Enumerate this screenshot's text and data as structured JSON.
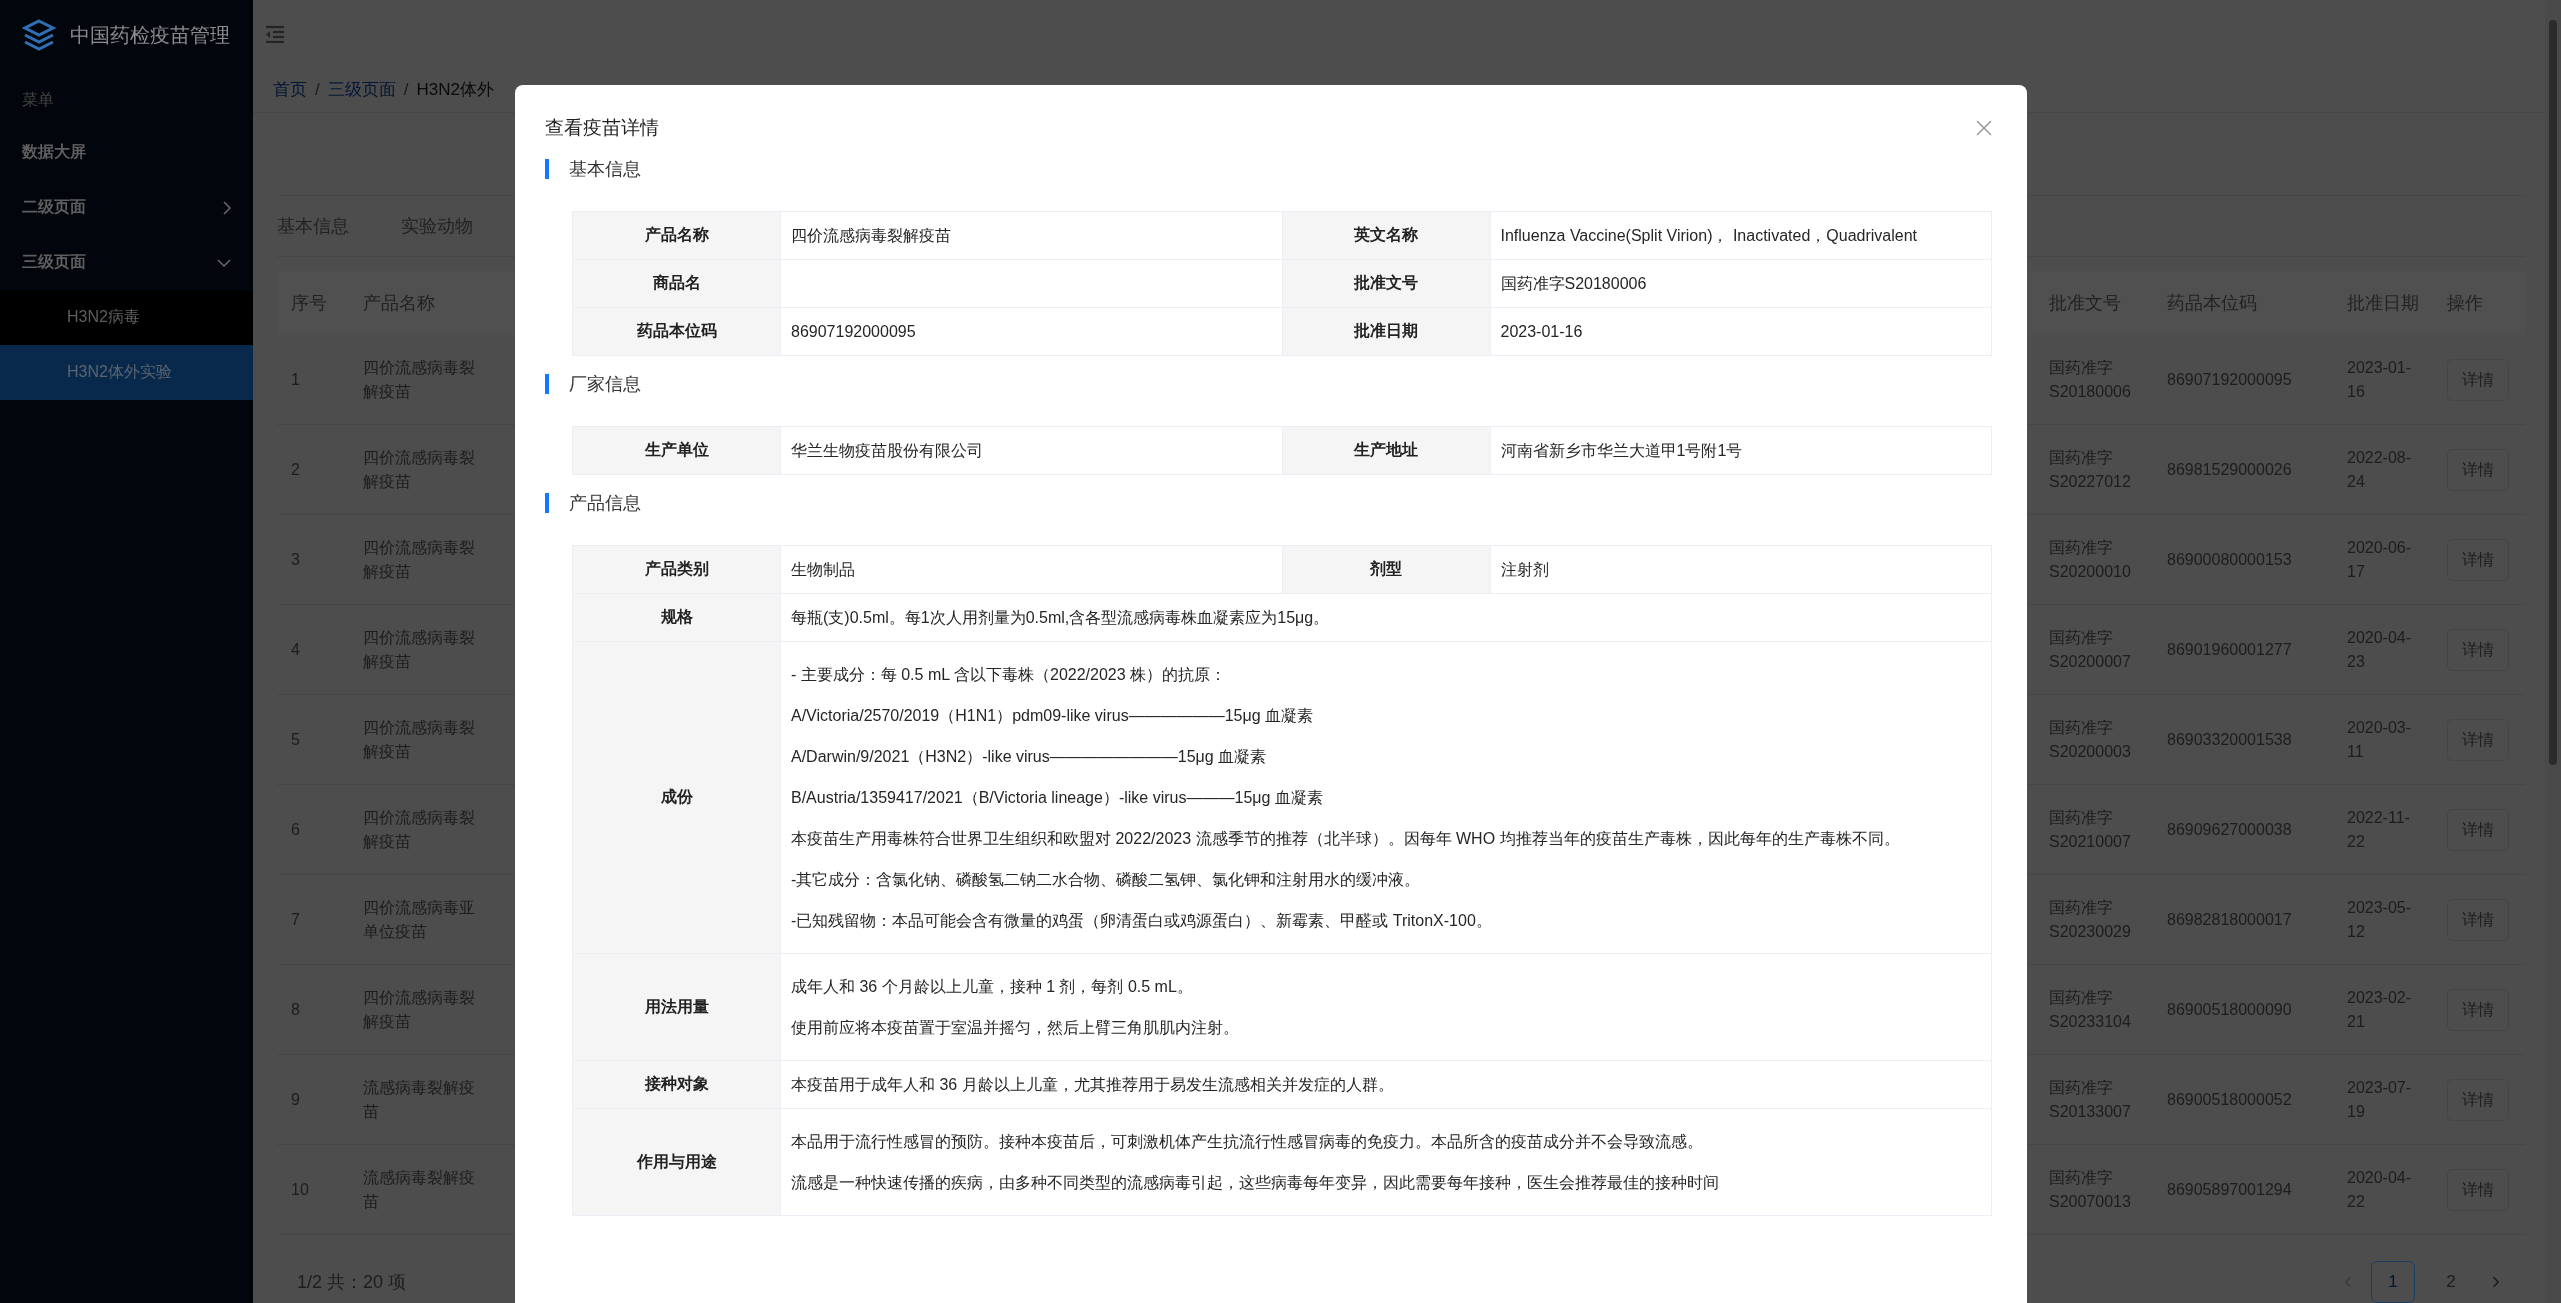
{
  "app": {
    "title": "中国药检疫苗管理"
  },
  "sidebar": {
    "group_title": "菜单",
    "items": [
      {
        "label": "数据大屏",
        "selected": false
      },
      {
        "label": "二级页面",
        "expanded": false,
        "selected": false
      },
      {
        "label": "三级页面",
        "expanded": true,
        "selected": false,
        "children": [
          {
            "label": "H3N2病毒",
            "selected": false
          },
          {
            "label": "H3N2体外实验",
            "selected": true
          }
        ]
      }
    ]
  },
  "breadcrumb": {
    "separator": "/",
    "items": [
      {
        "label": "首页",
        "kind": "link"
      },
      {
        "label": "三级页面",
        "kind": "link"
      },
      {
        "label": "H3N2体外",
        "kind": "current"
      }
    ]
  },
  "tabs": [
    {
      "label": "基本信息"
    },
    {
      "label": "实验动物"
    }
  ],
  "table": {
    "left_columns": [
      "序号",
      "产品名称"
    ],
    "right_columns": [
      "批准文号",
      "药品本位码",
      "批准日期",
      "操作"
    ],
    "rows": [
      {
        "index": "1",
        "name": "四价流感病毒裂解疫苗",
        "approval": "国药准字S20180006",
        "code": "86907192000095",
        "date": "2023-01-16",
        "action": "详情"
      },
      {
        "index": "2",
        "name": "四价流感病毒裂解疫苗",
        "approval": "国药准字S20227012",
        "code": "86981529000026",
        "date": "2022-08-24",
        "action": "详情"
      },
      {
        "index": "3",
        "name": "四价流感病毒裂解疫苗",
        "approval": "国药准字S20200010",
        "code": "86900080000153",
        "date": "2020-06-17",
        "action": "详情"
      },
      {
        "index": "4",
        "name": "四价流感病毒裂解疫苗",
        "approval": "国药准字S20200007",
        "code": "86901960001277",
        "date": "2020-04-23",
        "action": "详情"
      },
      {
        "index": "5",
        "name": "四价流感病毒裂解疫苗",
        "approval": "国药准字S20200003",
        "code": "86903320001538",
        "date": "2020-03-11",
        "action": "详情"
      },
      {
        "index": "6",
        "name": "四价流感病毒裂解疫苗",
        "approval": "国药准字S20210007",
        "code": "86909627000038",
        "date": "2022-11-22",
        "action": "详情"
      },
      {
        "index": "7",
        "name": "四价流感病毒亚单位疫苗",
        "approval": "国药准字S20230029",
        "code": "86982818000017",
        "date": "2023-05-12",
        "action": "详情"
      },
      {
        "index": "8",
        "name": "四价流感病毒裂解疫苗",
        "approval": "国药准字S20233104",
        "code": "86900518000090",
        "date": "2023-02-21",
        "action": "详情"
      },
      {
        "index": "9",
        "name": "流感病毒裂解疫苗",
        "approval": "国药准字S20133007",
        "code": "86900518000052",
        "date": "2023-07-19",
        "action": "详情"
      },
      {
        "index": "10",
        "name": "流感病毒裂解疫苗",
        "approval": "国药准字S20070013",
        "code": "86905897001294",
        "date": "2020-04-22",
        "action": "详情"
      }
    ]
  },
  "pagination": {
    "summary": "1/2 共：20 项",
    "pages": [
      {
        "label": "1",
        "selected": true
      },
      {
        "label": "2",
        "selected": false
      }
    ]
  },
  "modal": {
    "title": "查看疫苗详情",
    "sections": [
      {
        "title": "基本信息",
        "rows": [
          {
            "fields": [
              {
                "label": "产品名称",
                "lines": [
                  "四价流感病毒裂解疫苗"
                ]
              },
              {
                "label": "英文名称",
                "lines": [
                  "Influenza Vaccine(Split Virion)， Inactivated，Quadrivalent"
                ]
              }
            ]
          },
          {
            "fields": [
              {
                "label": "商品名"
              },
              {
                "label": "批准文号",
                "lines": [
                  "国药准字S20180006"
                ]
              }
            ]
          },
          {
            "fields": [
              {
                "label": "药品本位码",
                "lines": [
                  "86907192000095"
                ]
              },
              {
                "label": "批准日期",
                "lines": [
                  "2023-01-16"
                ]
              }
            ]
          }
        ]
      },
      {
        "title": "厂家信息",
        "rows": [
          {
            "fields": [
              {
                "label": "生产单位",
                "lines": [
                  "华兰生物疫苗股份有限公司"
                ]
              },
              {
                "label": "生产地址",
                "lines": [
                  "河南省新乡市华兰大道甲1号附1号"
                ]
              }
            ]
          }
        ]
      },
      {
        "title": "产品信息",
        "rows": [
          {
            "fields": [
              {
                "label": "产品类别",
                "lines": [
                  "生物制品"
                ]
              },
              {
                "label": "剂型",
                "lines": [
                  "注射剂"
                ]
              }
            ]
          },
          {
            "fields": [
              {
                "label": "规格",
                "lines": [
                  "每瓶(支)0.5ml。每1次人用剂量为0.5ml,含各型流感病毒株血凝素应为15μg。"
                ]
              }
            ]
          },
          {
            "fields": [
              {
                "label": "成份",
                "lines": [
                  "- 主要成分：每 0.5 mL 含以下毒株（2022/2023 株）的抗原：",
                  "A/Victoria/2570/2019（H1N1）pdm09-like virus——————15μg 血凝素",
                  "A/Darwin/9/2021（H3N2）-like virus————————15μg 血凝素",
                  "B/Austria/1359417/2021（B/Victoria lineage）-like virus———15μg 血凝素",
                  "本疫苗生产用毒株符合世界卫生组织和欧盟对 2022/2023 流感季节的推荐（北半球）。因每年 WHO 均推荐当年的疫苗生产毒株，因此每年的生产毒株不同。",
                  "-其它成分：含氯化钠、磷酸氢二钠二水合物、磷酸二氢钾、氯化钾和注射用水的缓冲液。",
                  "-已知残留物：本品可能会含有微量的鸡蛋（卵清蛋白或鸡源蛋白）、新霉素、甲醛或 TritonX-100。"
                ]
              }
            ]
          },
          {
            "fields": [
              {
                "label": "用法用量",
                "lines": [
                  "成年人和 36 个月龄以上儿童，接种 1 剂，每剂 0.5 mL。",
                  "使用前应将本疫苗置于室温并摇匀，然后上臂三角肌肌内注射。"
                ]
              }
            ]
          },
          {
            "fields": [
              {
                "label": "接种对象",
                "lines": [
                  "本疫苗用于成年人和 36 月龄以上儿童，尤其推荐用于易发生流感相关并发症的人群。"
                ]
              }
            ]
          },
          {
            "fields": [
              {
                "label": "作用与用途",
                "lines": [
                  "本品用于流行性感冒的预防。接种本疫苗后，可刺激机体产生抗流行性感冒病毒的免疫力。本品所含的疫苗成分并不会导致流感。",
                  "流感是一种快速传播的疾病，由多种不同类型的流感病毒引起，这些病毒每年变异，因此需要每年接种，医生会推荐最佳的接种时间"
                ]
              }
            ]
          }
        ]
      }
    ]
  }
}
